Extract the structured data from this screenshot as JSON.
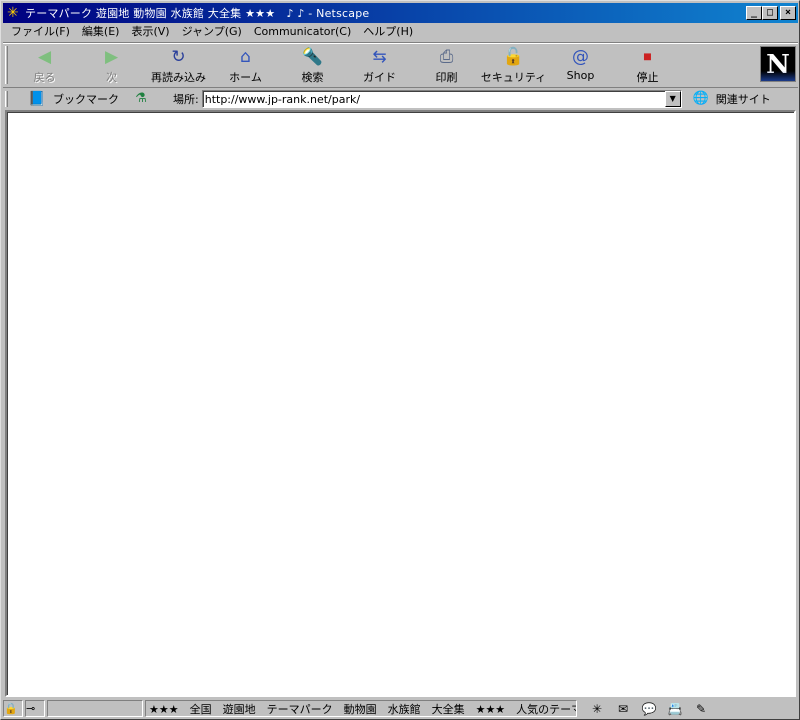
{
  "window": {
    "title": "テーマパーク 遊園地 動物園 水族館 大全集 ★★★　♪ ♪ - Netscape",
    "controls": {
      "minimize": "_",
      "maximize": "□",
      "close": "×"
    }
  },
  "menu": [
    "ファイル(F)",
    "編集(E)",
    "表示(V)",
    "ジャンプ(G)",
    "Communicator(C)",
    "ヘルプ(H)"
  ],
  "toolbar": {
    "back": "戻る",
    "forward": "次",
    "reload": "再読み込み",
    "home": "ホーム",
    "search": "検索",
    "guide": "ガイド",
    "print": "印刷",
    "security": "セキュリティ",
    "shop": "Shop",
    "stop": "停止",
    "logo": "N"
  },
  "location": {
    "bookmarks_label": "ブックマーク",
    "label": "場所:",
    "url": "http://www.jp-rank.net/park/",
    "related_label": "関連サイト"
  },
  "status": {
    "text": "★★★　全国　遊園地　テーマパーク　動物園　水族館　大全集　★★★　人気のテーマサ"
  },
  "colors": {
    "titlebar_start": "#000080",
    "titlebar_end": "#1084d0",
    "chrome": "#c0c0c0",
    "content_bg": "#ffffff"
  }
}
